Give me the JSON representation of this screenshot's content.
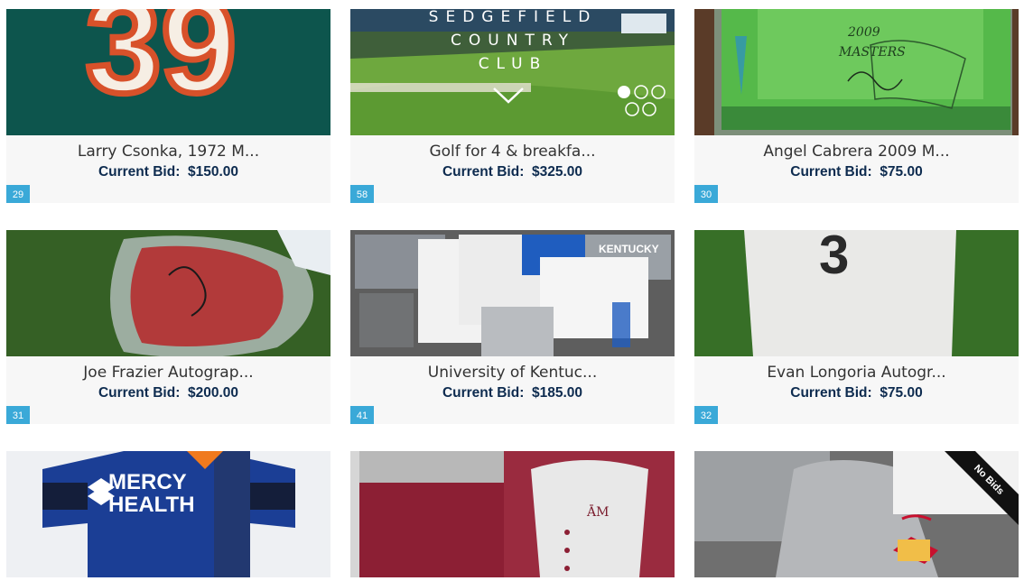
{
  "bid_label": "Current Bid:",
  "items": [
    {
      "title": "Larry Csonka, 1972 M...",
      "bid": "$150.00",
      "number": "29"
    },
    {
      "title": "Golf for 4 & breakfa...",
      "bid": "$325.00",
      "number": "58",
      "image_text": {
        "line1": "SEDGEFIELD",
        "line2": "COUNTRY",
        "line3": "CLUB"
      }
    },
    {
      "title": "Angel Cabrera 2009 M...",
      "bid": "$75.00",
      "number": "30",
      "image_text": {
        "year": "2009",
        "event": "MASTERS"
      }
    },
    {
      "title": "Joe Frazier Autograp...",
      "bid": "$200.00",
      "number": "31"
    },
    {
      "title": "University of Kentuc...",
      "bid": "$185.00",
      "number": "41",
      "image_text": {
        "word": "KENTUCKY"
      }
    },
    {
      "title": "Evan Longoria Autogr...",
      "bid": "$75.00",
      "number": "32"
    },
    {
      "image_text": {
        "line1": "MERCY",
        "line2": "HEALTH"
      }
    },
    {},
    {
      "ribbon": "No Bids"
    }
  ],
  "jersey_number": "39",
  "jersey_number_2": "3"
}
